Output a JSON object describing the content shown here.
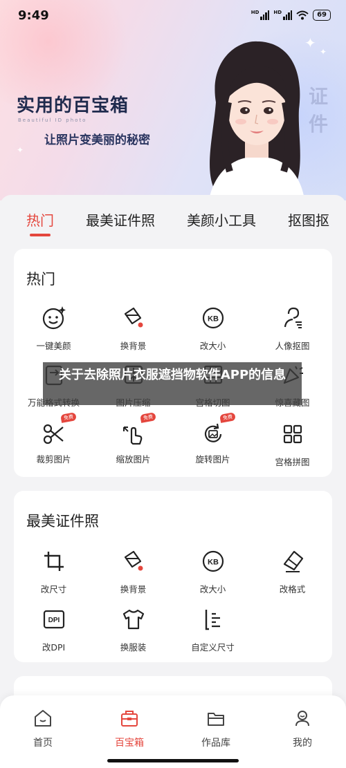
{
  "status_bar": {
    "time": "9:49",
    "battery": "69"
  },
  "banner": {
    "title": "实用的百宝箱",
    "subtitle_en": "Beautiful ID photo",
    "subtitle": "让照片变美丽的秘密",
    "side_text": "证件"
  },
  "tabs": [
    {
      "label": "热门",
      "active": true
    },
    {
      "label": "最美证件照",
      "active": false
    },
    {
      "label": "美颜小工具",
      "active": false
    },
    {
      "label": "抠图抠",
      "active": false
    }
  ],
  "hot_section": {
    "title": "热门",
    "items": [
      {
        "label": "一键美颜",
        "icon": "smile-sparkle-icon"
      },
      {
        "label": "换背景",
        "icon": "paint-bucket-icon"
      },
      {
        "label": "改大小",
        "icon": "kb-icon"
      },
      {
        "label": "人像抠图",
        "icon": "person-cutout-icon"
      },
      {
        "label": "万能格式转换",
        "icon": "format-convert-icon"
      },
      {
        "label": "图片压缩",
        "icon": "compress-icon"
      },
      {
        "label": "宫格切图",
        "icon": "grid-cut-icon"
      },
      {
        "label": "惊喜藏图",
        "icon": "party-popper-icon"
      },
      {
        "label": "裁剪图片",
        "icon": "scissors-icon",
        "badge": "免费"
      },
      {
        "label": "缩放图片",
        "icon": "pinch-zoom-icon",
        "badge": "免费"
      },
      {
        "label": "旋转图片",
        "icon": "rotate-image-icon",
        "badge": "免费"
      },
      {
        "label": "宫格拼图",
        "icon": "grid-collage-icon"
      }
    ]
  },
  "id_section": {
    "title": "最美证件照",
    "items": [
      {
        "label": "改尺寸",
        "icon": "crop-frame-icon"
      },
      {
        "label": "换背景",
        "icon": "paint-bucket-icon"
      },
      {
        "label": "改大小",
        "icon": "kb-icon"
      },
      {
        "label": "改格式",
        "icon": "eraser-icon"
      },
      {
        "label": "改DPI",
        "icon": "dpi-icon"
      },
      {
        "label": "换服装",
        "icon": "tshirt-icon"
      },
      {
        "label": "自定义尺寸",
        "icon": "ruler-icon"
      }
    ]
  },
  "overlay_caption": "关于去除照片衣服遮挡物软件APP的信息",
  "bottom_nav": [
    {
      "label": "首页",
      "icon": "home-icon",
      "active": false
    },
    {
      "label": "百宝箱",
      "icon": "toolbox-icon",
      "active": true
    },
    {
      "label": "作品库",
      "icon": "folder-icon",
      "active": false
    },
    {
      "label": "我的",
      "icon": "profile-icon",
      "active": false
    }
  ],
  "colors": {
    "accent": "#e4463d",
    "text": "#222222",
    "background": "#f3f3f5"
  }
}
